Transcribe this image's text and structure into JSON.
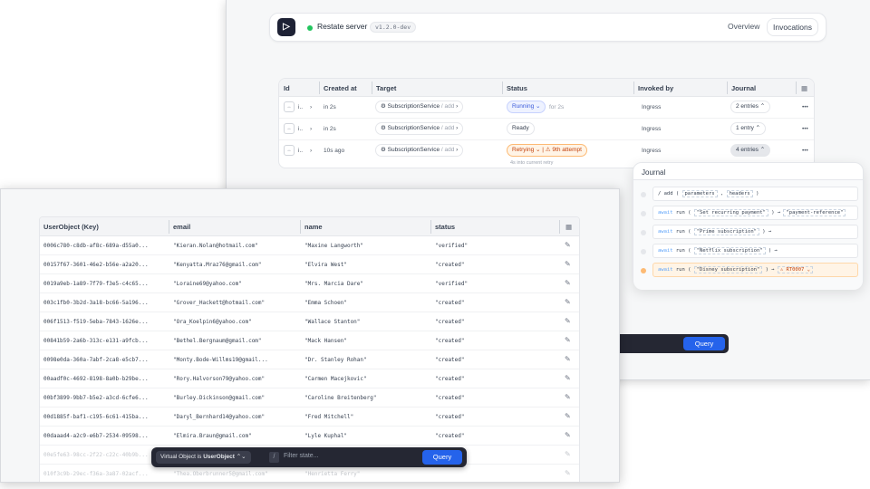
{
  "back": {
    "server": {
      "name": "Restate server",
      "version": "v1.2.0-dev"
    },
    "nav": {
      "overview": "Overview",
      "invocations": "Invocations"
    },
    "table": {
      "headers": [
        "Id",
        "Created at",
        "Target",
        "Status",
        "Invoked by",
        "Journal"
      ],
      "rows": [
        {
          "id": "i..",
          "created": "in 2s",
          "target": "SubscriptionService",
          "handler": "/ add",
          "status": "Running",
          "status_extra": "for 2s",
          "invoked_by": "Ingress",
          "journal": "2 entries"
        },
        {
          "id": "i..",
          "created": "in 2s",
          "target": "SubscriptionService",
          "handler": "/ add",
          "status": "Ready",
          "status_extra": "",
          "invoked_by": "Ingress",
          "journal": "1 entry"
        },
        {
          "id": "i..",
          "created": "10s ago",
          "target": "SubscriptionService",
          "handler": "/ add",
          "status": "Retrying",
          "status_extra": "9th attempt",
          "status_sub": "4s into current retry",
          "invoked_by": "Ingress",
          "journal": "4 entries"
        }
      ]
    },
    "journal": {
      "title": "Journal",
      "lines": [
        {
          "prefix": "/ add (",
          "args": [
            "parameters",
            "headers"
          ],
          "suffix": ")"
        },
        {
          "kw": "await",
          "fn": "run",
          "arg": "\"Set recurring payment\"",
          "result": "\"payment-reference\""
        },
        {
          "kw": "await",
          "fn": "run",
          "arg": "\"Prime subscription\"",
          "result": ""
        },
        {
          "kw": "await",
          "fn": "run",
          "arg": "\"Netflix subscription\"",
          "result": ""
        },
        {
          "kw": "await",
          "fn": "run",
          "arg": "\"Disney subscription\"",
          "result": "RT0007"
        }
      ]
    },
    "query_label": "Query"
  },
  "front": {
    "headers": [
      "UserObject (Key)",
      "email",
      "name",
      "status"
    ],
    "rows": [
      {
        "key": "0006c780-c8db-af8c-689a-d55a0...",
        "email": "\"Kieran.Nolan@hotmail.com\"",
        "name": "\"Maxine Langworth\"",
        "status": "\"verified\""
      },
      {
        "key": "00157f67-3601-46e2-b56e-a2a20...",
        "email": "\"Kenyatta.Mraz76@gmail.com\"",
        "name": "\"Elvira West\"",
        "status": "\"created\""
      },
      {
        "key": "0019a9eb-1a89-7f79-f3e5-c4c65...",
        "email": "\"Loraine69@yahoo.com\"",
        "name": "\"Mrs. Marcia Dare\"",
        "status": "\"verified\""
      },
      {
        "key": "003c1fb0-3b2d-3a18-bc66-5a196...",
        "email": "\"Grover_Hackett@hotmail.com\"",
        "name": "\"Emma Schoen\"",
        "status": "\"created\""
      },
      {
        "key": "006f1513-f519-5eba-7843-1626e...",
        "email": "\"Ora_Koelpin6@yahoo.com\"",
        "name": "\"Wallace Stanton\"",
        "status": "\"created\""
      },
      {
        "key": "00841b59-2a6b-313c-e131-a9fcb...",
        "email": "\"Bethel.Bergnaum@gmail.com\"",
        "name": "\"Mack Hansen\"",
        "status": "\"created\""
      },
      {
        "key": "0098e0da-360a-7abf-2ca8-e5cb7...",
        "email": "\"Monty.Bode-Willms19@gmail...",
        "name": "\"Dr. Stanley Rohan\"",
        "status": "\"created\""
      },
      {
        "key": "00aadf0c-4692-8198-8a0b-b29be...",
        "email": "\"Rory.Halvorson79@yahoo.com\"",
        "name": "\"Carmen Macejkovic\"",
        "status": "\"created\""
      },
      {
        "key": "00bf3899-9bb7-b5e2-a3cd-6cfe6...",
        "email": "\"Burley.Dickinson@gmail.com\"",
        "name": "\"Caroline Breitenberg\"",
        "status": "\"created\""
      },
      {
        "key": "00d1885f-baf1-c195-6c61-415ba...",
        "email": "\"Daryl_Bernhard14@yahoo.com\"",
        "name": "\"Fred Mitchell\"",
        "status": "\"created\""
      },
      {
        "key": "00daaad4-a2c9-e6b7-2534-09598...",
        "email": "\"Elmira.Braun@gmail.com\"",
        "name": "\"Lyle Kuphal\"",
        "status": "\"created\""
      },
      {
        "key": "00e5fe63-98cc-2f22-c22c-40b9b...",
        "email": "",
        "name": "",
        "status": ""
      },
      {
        "key": "010f3c9b-29ec-f36a-3a87-02acf...",
        "email": "\"Thea.Oberbrunner5@gmail.com\"",
        "name": "\"Henrietta Ferry\"",
        "status": ""
      }
    ],
    "query_bar": {
      "label": "Virtual Object is",
      "value": "UserObject",
      "filter_placeholder": "Filter state...",
      "query_label": "Query"
    }
  }
}
